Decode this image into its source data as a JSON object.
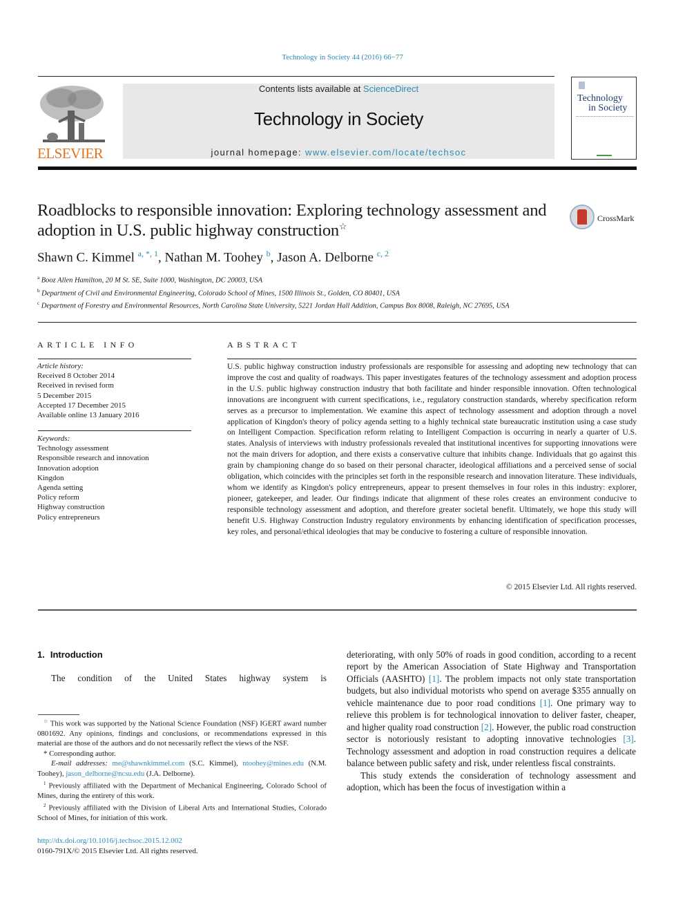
{
  "header": {
    "running_head": "Technology in Society 44 (2016) 66−77",
    "contents_prefix": "Contents lists available at ",
    "contents_link": "ScienceDirect",
    "journal_title": "Technology in Society",
    "homepage_prefix": "journal homepage: ",
    "homepage_link": "www.elsevier.com/locate/techsoc",
    "publisher_logo": "ELSEVIER",
    "cover_title_line1": "Technology",
    "cover_title_line2": "in Society",
    "crossmark_label": "CrossMark"
  },
  "article": {
    "title": "Roadblocks to responsible innovation: Exploring technology assessment and adoption in U.S. public highway construction",
    "title_mark": "☆",
    "authors": [
      {
        "name": "Shawn C. Kimmel",
        "sup": "a, *, 1",
        "sep": ", "
      },
      {
        "name": "Nathan M. Toohey",
        "sup": "b",
        "sep": ", "
      },
      {
        "name": "Jason A. Delborne",
        "sup": "c, 2",
        "sep": ""
      }
    ],
    "affiliations": [
      {
        "key": "a",
        "text": "Booz Allen Hamilton, 20 M St. SE, Suite 1000, Washington, DC 20003, USA"
      },
      {
        "key": "b",
        "text": "Department of Civil and Environmental Engineering, Colorado School of Mines, 1500 Illinois St., Golden, CO 80401, USA"
      },
      {
        "key": "c",
        "text": "Department of Forestry and Environmental Resources, North Carolina State University, 5221 Jordan Hall Addition, Campus Box 8008, Raleigh, NC 27695, USA"
      }
    ]
  },
  "article_info": {
    "heading": "ARTICLE INFO",
    "history_label": "Article history:",
    "history": [
      "Received 8 October 2014",
      "Received in revised form",
      "5 December 2015",
      "Accepted 17 December 2015",
      "Available online 13 January 2016"
    ],
    "keywords_label": "Keywords:",
    "keywords": [
      "Technology assessment",
      "Responsible research and innovation",
      "Innovation adoption",
      "Kingdon",
      "Agenda setting",
      "Policy reform",
      "Highway construction",
      "Policy entrepreneurs"
    ]
  },
  "abstract": {
    "heading": "ABSTRACT",
    "text": "U.S. public highway construction industry professionals are responsible for assessing and adopting new technology that can improve the cost and quality of roadways. This paper investigates features of the technology assessment and adoption process in the U.S. public highway construction industry that both facilitate and hinder responsible innovation. Often technological innovations are incongruent with current specifications, i.e., regulatory construction standards, whereby specification reform serves as a precursor to implementation. We examine this aspect of technology assessment and adoption through a novel application of Kingdon's theory of policy agenda setting to a highly technical state bureaucratic institution using a case study on Intelligent Compaction. Specification reform relating to Intelligent Compaction is occurring in nearly a quarter of U.S. states. Analysis of interviews with industry professionals revealed that institutional incentives for supporting innovations were not the main drivers for adoption, and there exists a conservative culture that inhibits change. Individuals that go against this grain by championing change do so based on their personal character, ideological affiliations and a perceived sense of social obligation, which coincides with the principles set forth in the responsible research and innovation literature. These individuals, whom we identify as Kingdon's policy entrepreneurs, appear to present themselves in four roles in this industry: explorer, pioneer, gatekeeper, and leader. Our findings indicate that alignment of these roles creates an environment conducive to responsible technology assessment and adoption, and therefore greater societal benefit. Ultimately, we hope this study will benefit U.S. Highway Construction Industry regulatory environments by enhancing identification of specification processes, key roles, and personal/ethical ideologies that may be conducive to fostering a culture of responsible innovation.",
    "copyright": "© 2015 Elsevier Ltd. All rights reserved."
  },
  "introduction": {
    "number": "1.",
    "heading": "Introduction",
    "left_text": "The condition of the United States highway system is",
    "right_p1_parts": [
      "deteriorating, with only 50% of roads in good condition, according to a recent report by the American Association of State Highway and Transportation Officials (AASHTO) ",
      "[1]",
      ". The problem impacts not only state transportation budgets, but also individual motorists who spend on average $355 annually on vehicle maintenance due to poor road conditions ",
      "[1]",
      ". One primary way to relieve this problem is for technological innovation to deliver faster, cheaper, and higher quality road construction ",
      "[2]",
      ". However, the public road construction sector is notoriously resistant to adopting innovative technologies ",
      "[3]",
      ". Technology assessment and adoption in road construction requires a delicate balance between public safety and risk, under relentless fiscal constraints."
    ],
    "right_p2": "This study extends the consideration of technology assessment and adoption, which has been the focus of investigation within a"
  },
  "footnotes": {
    "funding_mark": "☆",
    "funding": "This work was supported by the National Science Foundation (NSF) IGERT award number 0801692. Any opinions, findings and conclusions, or recommendations expressed in this material are those of the authors and do not necessarily reflect the views of the NSF.",
    "corresponding_mark": "*",
    "corresponding": "Corresponding author.",
    "email_label": "E-mail addresses:",
    "emails": [
      {
        "address": "me@shawnkimmel.com",
        "who": " (S.C. Kimmel), "
      },
      {
        "address": "ntoohey@mines.edu",
        "who": " (N.M. Toohey), "
      },
      {
        "address": "jason_delborne@ncsu.edu",
        "who": " (J.A. Delborne)."
      }
    ],
    "note1_mark": "1",
    "note1": "Previously affiliated with the Department of Mechanical Engineering, Colorado School of Mines, during the entirety of this work.",
    "note2_mark": "2",
    "note2": "Previously affiliated with the Division of Liberal Arts and International Studies, Colorado School of Mines, for initiation of this work."
  },
  "doi": {
    "link": "http://dx.doi.org/10.1016/j.techsoc.2015.12.002",
    "issn_line": "0160-791X/© 2015 Elsevier Ltd. All rights reserved."
  },
  "colors": {
    "link": "#2a8ab8",
    "elsevier_orange": "#e5731d",
    "masthead_bg": "#e8e8e8"
  }
}
